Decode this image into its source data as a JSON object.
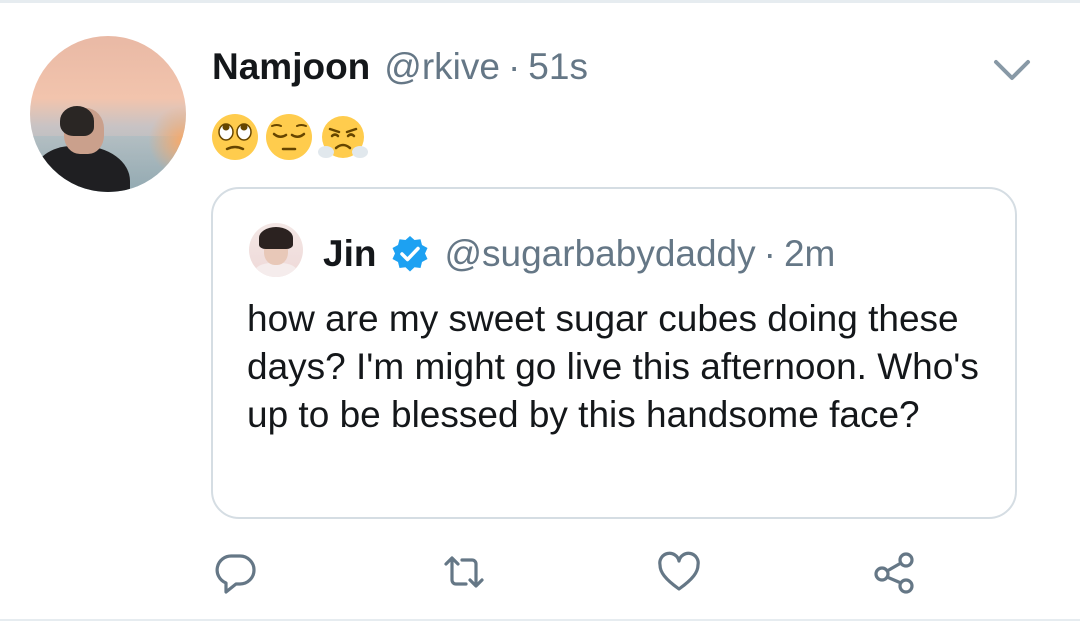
{
  "tweet": {
    "author_name": "Namjoon",
    "author_handle": "@rkive",
    "separator": "·",
    "timestamp": "51s",
    "emojis": [
      "face-with-rolling-eyes",
      "pensive-face",
      "face-with-steam-from-nose"
    ]
  },
  "quoted_tweet": {
    "author_name": "Jin",
    "verified": true,
    "author_handle": "@sugarbabydaddy",
    "separator": "·",
    "timestamp": "2m",
    "text": "how are my sweet sugar cubes doing these days? I'm might go live this afternoon. Who's up to be blessed by this handsome face?"
  },
  "actions": {
    "icons": [
      "reply-icon",
      "retweet-icon",
      "like-icon",
      "share-icon"
    ]
  },
  "colors": {
    "text_primary": "#14171a",
    "text_secondary": "#657786",
    "verified_blue": "#1da1f2",
    "icon_gray": "#657786",
    "border": "#d5dde3"
  }
}
